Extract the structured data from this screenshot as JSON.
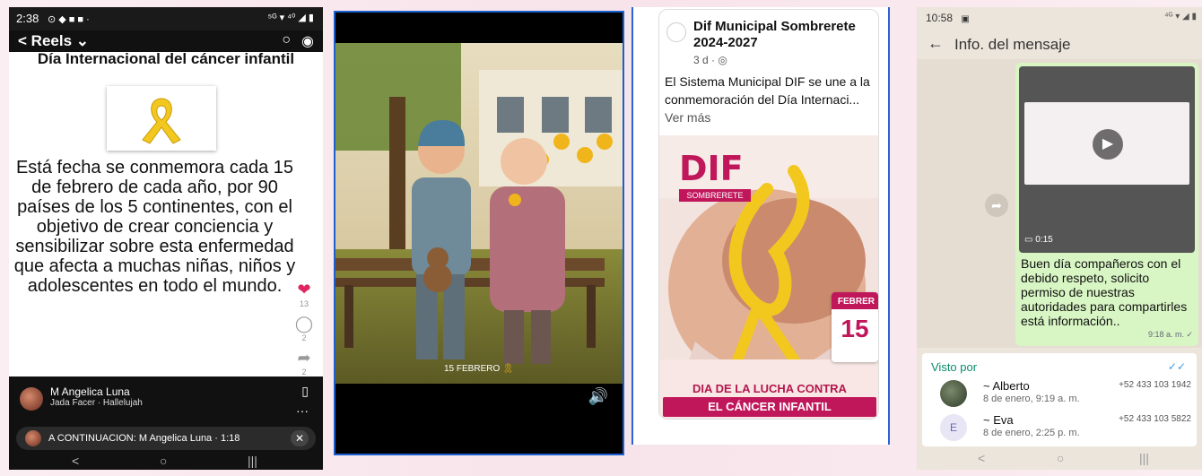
{
  "panel1": {
    "status_time": "2:38",
    "status_icons": "⊙ ◆ ■ ■ ·",
    "status_right": "⁵ᴳ ▾ ⁴⁰ ◢ ▮",
    "reels_label": "Reels",
    "title": "Día Internacional del cáncer infantil",
    "body": "Está  fecha se conmemora cada 15 de febrero de cada año, por 90 países de los 5 continentes, con el objetivo de crear conciencia y sensibilizar sobre esta enfermedad que afecta a muchas niñas, niños y adolescentes en todo el mundo.",
    "like_count": "13",
    "comment_count": "2",
    "share_count": "2",
    "user_name": "M Angelica Luna",
    "song": "Jada Facer · Hallelujah",
    "next_label": "A CONTINUACION: M Angelica Luna · 1:18"
  },
  "panel2": {
    "caption": "15 FEBRERO"
  },
  "panel3": {
    "page_name": "Dif Municipal Sombrerete 2024-2027",
    "meta": "3 d · ◎",
    "post_text": "El Sistema Municipal DIF se une a la conmemoración del Día Internaci...",
    "see_more": "Ver más",
    "logo_text": "DIF",
    "logo_sub": "SOMBRERETE",
    "cal_month": "FEBRER",
    "cal_day": "15",
    "banner_line1": "DIA  DE LA LUCHA CONTRA",
    "banner_line2": "EL CÁNCER INFANTIL"
  },
  "panel4": {
    "status_time": "10:58",
    "status_right": "⁴ᴳ ▾ ◢ ▮",
    "header_title": "Info. del mensaje",
    "video_duration": "0:15",
    "message": "Buen día compañeros con el debido respeto, solicito permiso de nuestras autoridades para compartirles está información..",
    "message_time": "9:18 a. m. ✓",
    "seen_label": "Visto por",
    "viewers": [
      {
        "name": "~ Alberto",
        "time": "8 de enero, 9:19 a. m.",
        "phone": "+52 433 103 1942",
        "initial": ""
      },
      {
        "name": "~ Eva",
        "time": "8 de enero, 2:25 p. m.",
        "phone": "+52 433 103 5822",
        "initial": "E"
      }
    ]
  }
}
